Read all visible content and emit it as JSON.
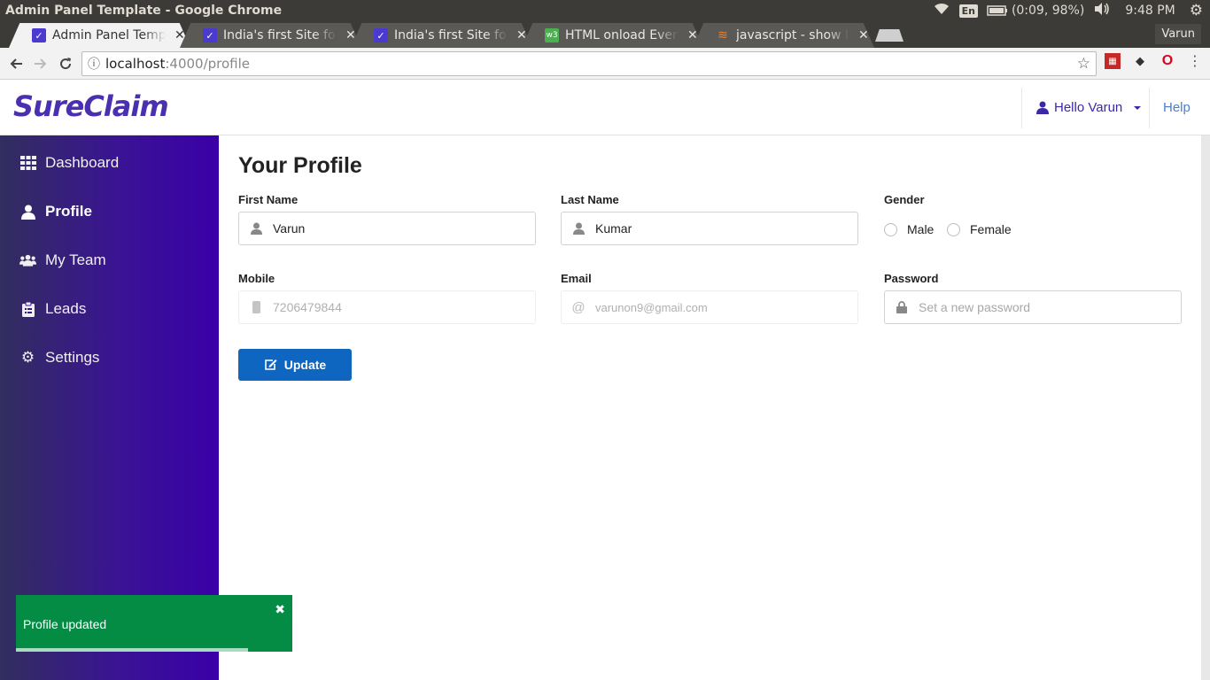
{
  "os": {
    "window_title": "Admin Panel Template - Google Chrome",
    "lang": "En",
    "battery": "(0:09, 98%)",
    "time": "9:48 PM"
  },
  "browser": {
    "tabs": [
      {
        "title": "Admin Panel Template - Google Chrome",
        "short": "Admin Panel Templa",
        "favicon_color": "#4a3ad0",
        "active": true
      },
      {
        "title": "India's first Site for",
        "short": "India's first Site for",
        "favicon_color": "#4a3ad0",
        "active": false
      },
      {
        "title": "India's first Site for",
        "short": "India's first Site for",
        "favicon_color": "#4a3ad0",
        "active": false
      },
      {
        "title": "HTML onload Event",
        "short": "HTML onload Event",
        "favicon_color": "#4caf50",
        "active": false
      },
      {
        "title": "javascript - show lo",
        "short": "javascript - show lo",
        "favicon_color": "#f48024",
        "active": false
      }
    ],
    "tab_close_glyph": "✕",
    "profile_name": "Varun",
    "url_host": "localhost",
    "url_path": ":4000/profile"
  },
  "header": {
    "brand": "SureClaim",
    "user_greeting": "Hello Varun",
    "help": "Help"
  },
  "sidebar": {
    "items": [
      {
        "label": "Dashboard",
        "icon": "grid-icon",
        "active": false
      },
      {
        "label": "Profile",
        "icon": "user-icon",
        "active": true
      },
      {
        "label": "My Team",
        "icon": "users-icon",
        "active": false
      },
      {
        "label": "Leads",
        "icon": "clipboard-icon",
        "active": false
      },
      {
        "label": "Settings",
        "icon": "cogs-icon",
        "active": false
      }
    ]
  },
  "profile": {
    "title": "Your Profile",
    "first_name_label": "First Name",
    "first_name_value": "Varun",
    "last_name_label": "Last Name",
    "last_name_value": "Kumar",
    "gender_label": "Gender",
    "gender_options": [
      "Male",
      "Female"
    ],
    "mobile_label": "Mobile",
    "mobile_value": "7206479844",
    "email_label": "Email",
    "email_value": "varunon9@gmail.com",
    "password_label": "Password",
    "password_placeholder": "Set a new password",
    "update_button": "Update"
  },
  "toast": {
    "message": "Profile updated",
    "close_glyph": "✖",
    "progress": 0.84
  },
  "colors": {
    "brand": "#4a2fb0",
    "sidebar_start": "#322e5e",
    "sidebar_end": "#3a00a8",
    "primary_button": "#0f66c0",
    "toast_bg": "#048c44"
  }
}
